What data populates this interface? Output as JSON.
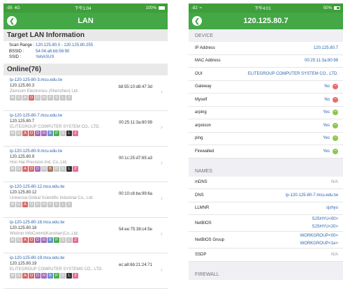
{
  "left": {
    "status": {
      "signal": "-95",
      "net": "4G",
      "time": "下午1:04",
      "battery": "100%"
    },
    "title": "LAN",
    "target": {
      "heading": "Target LAN Information",
      "rows": [
        {
          "key": "Scan Range :",
          "value": "120.125.80.0 - 120.125.80.255"
        },
        {
          "key": "BSSID :",
          "value": "54:04:a6:bb:56:90"
        },
        {
          "key": "SSID :",
          "value": "YehASUS"
        }
      ]
    },
    "online_heading": "Online(76)",
    "devices": [
      {
        "host": "ip-120-125-80-3.mcu.edu.tw",
        "ip": "120.125.80.3",
        "mac": "b8:55:10:d8:47:3d",
        "vendor": "Zioncom Electronics (Shenzhen) Ltd.",
        "tags": [
          "M",
          "G",
          "A",
          "O",
          "D",
          "N",
          "P",
          "S",
          "L",
          "Z"
        ],
        "colors": [
          "#c8c8c8",
          "#c8c8c8",
          "#c8c8c8",
          "#d86a6a",
          "#c8c8c8",
          "#c8c8c8",
          "#c8c8c8",
          "#c8c8c8",
          "#c8c8c8",
          "#c8c8c8"
        ]
      },
      {
        "host": "ip-120-125-80-7.mcu.edu.tw",
        "ip": "120.125.80.7",
        "mac": "00:25:11:3a:80:99",
        "vendor": "ELITEGROUP COMPUTER SYSTEM CO., LTD.",
        "tags": [
          "M",
          "G",
          "A",
          "O",
          "D",
          "N",
          "B",
          "P",
          "S",
          "L",
          "Z"
        ],
        "colors": [
          "#c8c8c8",
          "#c8c8c8",
          "#d86a6a",
          "#d86a6a",
          "#a06cb8",
          "#a06cb8",
          "#6b8fd1",
          "#4caf50",
          "#c8c8c8",
          "#333333",
          "#e56b9a"
        ]
      },
      {
        "host": "ip-120-125-80-9.mcu.edu.tw",
        "ip": "120.125.80.9",
        "mac": "00:1c:25:d7:65:a3",
        "vendor": "Hon Hai Precision Ind. Co.,Ltd.",
        "tags": [
          "M",
          "G",
          "A",
          "O",
          "D",
          "N",
          "B",
          "P",
          "S",
          "L",
          "Z"
        ],
        "colors": [
          "#c8c8c8",
          "#c8c8c8",
          "#d86a6a",
          "#d86a6a",
          "#a06cb8",
          "#c8c8c8",
          "#a07860",
          "#c8c8c8",
          "#c8c8c8",
          "#333333",
          "#e56b9a"
        ]
      },
      {
        "host": "ip-120-125-80-12.mcu.edu.tw",
        "ip": "120.125.80.12",
        "mac": "00:10:c6:ba:99:6a",
        "vendor": "Universal Global Scientific Industrial Co., Ltd.",
        "tags": [
          "M",
          "G",
          "A",
          "O",
          "D",
          "N",
          "P",
          "S",
          "L",
          "Z"
        ],
        "colors": [
          "#c8c8c8",
          "#c8c8c8",
          "#d86a6a",
          "#c8c8c8",
          "#c8c8c8",
          "#c8c8c8",
          "#c8c8c8",
          "#c8c8c8",
          "#c8c8c8",
          "#c8c8c8"
        ]
      },
      {
        "host": "ip-120-125-80-18.mcu.edu.tw",
        "ip": "120.125.80.18",
        "mac": "54:ee:75:38:c4:5e",
        "vendor": "Wistron InfoComm(Kunshan)Co.,Ltd.",
        "tags": [
          "M",
          "G",
          "A",
          "O",
          "D",
          "N",
          "B",
          "P",
          "S",
          "L",
          "Z"
        ],
        "colors": [
          "#c8c8c8",
          "#c8c8c8",
          "#d86a6a",
          "#d86a6a",
          "#a06cb8",
          "#a06cb8",
          "#6b8fd1",
          "#4caf50",
          "#c8c8c8",
          "#c8c8c8",
          "#e56b9a"
        ]
      },
      {
        "host": "ip-120-125-80-19.mcu.edu.tw",
        "ip": "120.125.80.19",
        "mac": "ec:a8:6b:21:24:71",
        "vendor": "ELITEGROUP COMPUTER SYSTEMS CO., LTD.",
        "tags": [
          "M",
          "G",
          "A",
          "O",
          "D",
          "N",
          "B",
          "P",
          "S",
          "L",
          "Z"
        ],
        "colors": [
          "#c8c8c8",
          "#c8c8c8",
          "#d86a6a",
          "#d86a6a",
          "#a06cb8",
          "#a06cb8",
          "#6b8fd1",
          "#4caf50",
          "#c8c8c8",
          "#333333",
          "#e56b9a"
        ]
      }
    ]
  },
  "right": {
    "status": {
      "signal": "-82",
      "time": "下午4:01",
      "battery": "50%"
    },
    "title": "120.125.80.7",
    "device_heading": "DEVICE",
    "device_rows": [
      {
        "label": "IP Address",
        "value": "120.125.80.7"
      },
      {
        "label": "MAC Address",
        "value": "00:25:11:3a:80:99"
      },
      {
        "label": "OUI",
        "value": "ELITEGROUP COMPUTER SYSTEM CO., LTD."
      },
      {
        "label": "Gateway",
        "value": "No",
        "state": "red"
      },
      {
        "label": "Myself",
        "value": "No",
        "state": "red"
      },
      {
        "label": "arping",
        "value": "Yes",
        "state": "green"
      },
      {
        "label": "arpoison",
        "value": "Yes",
        "state": "green"
      },
      {
        "label": "ping",
        "value": "Yes",
        "state": "green"
      },
      {
        "label": "Firewalled",
        "value": "Yes",
        "state": "green"
      }
    ],
    "names_heading": "NAMES",
    "names_rows": [
      {
        "label": "mDNS",
        "value": "N/A"
      },
      {
        "label": "DNS",
        "value": "ip-120-125-80-7.mcu.edu.tw"
      },
      {
        "label": "LLMNR",
        "value": "sjshyu"
      },
      {
        "label": "NetBIOS",
        "lines": [
          "SJSHYU<00>",
          "SJSHYU<20>"
        ]
      },
      {
        "label": "NetBIOS Group",
        "lines": [
          "WORKGROUP<00>",
          "WORKGROUP<1e>"
        ]
      },
      {
        "label": "SSDP",
        "value": "N/A"
      }
    ],
    "firewall_heading": "FIREWALL"
  }
}
